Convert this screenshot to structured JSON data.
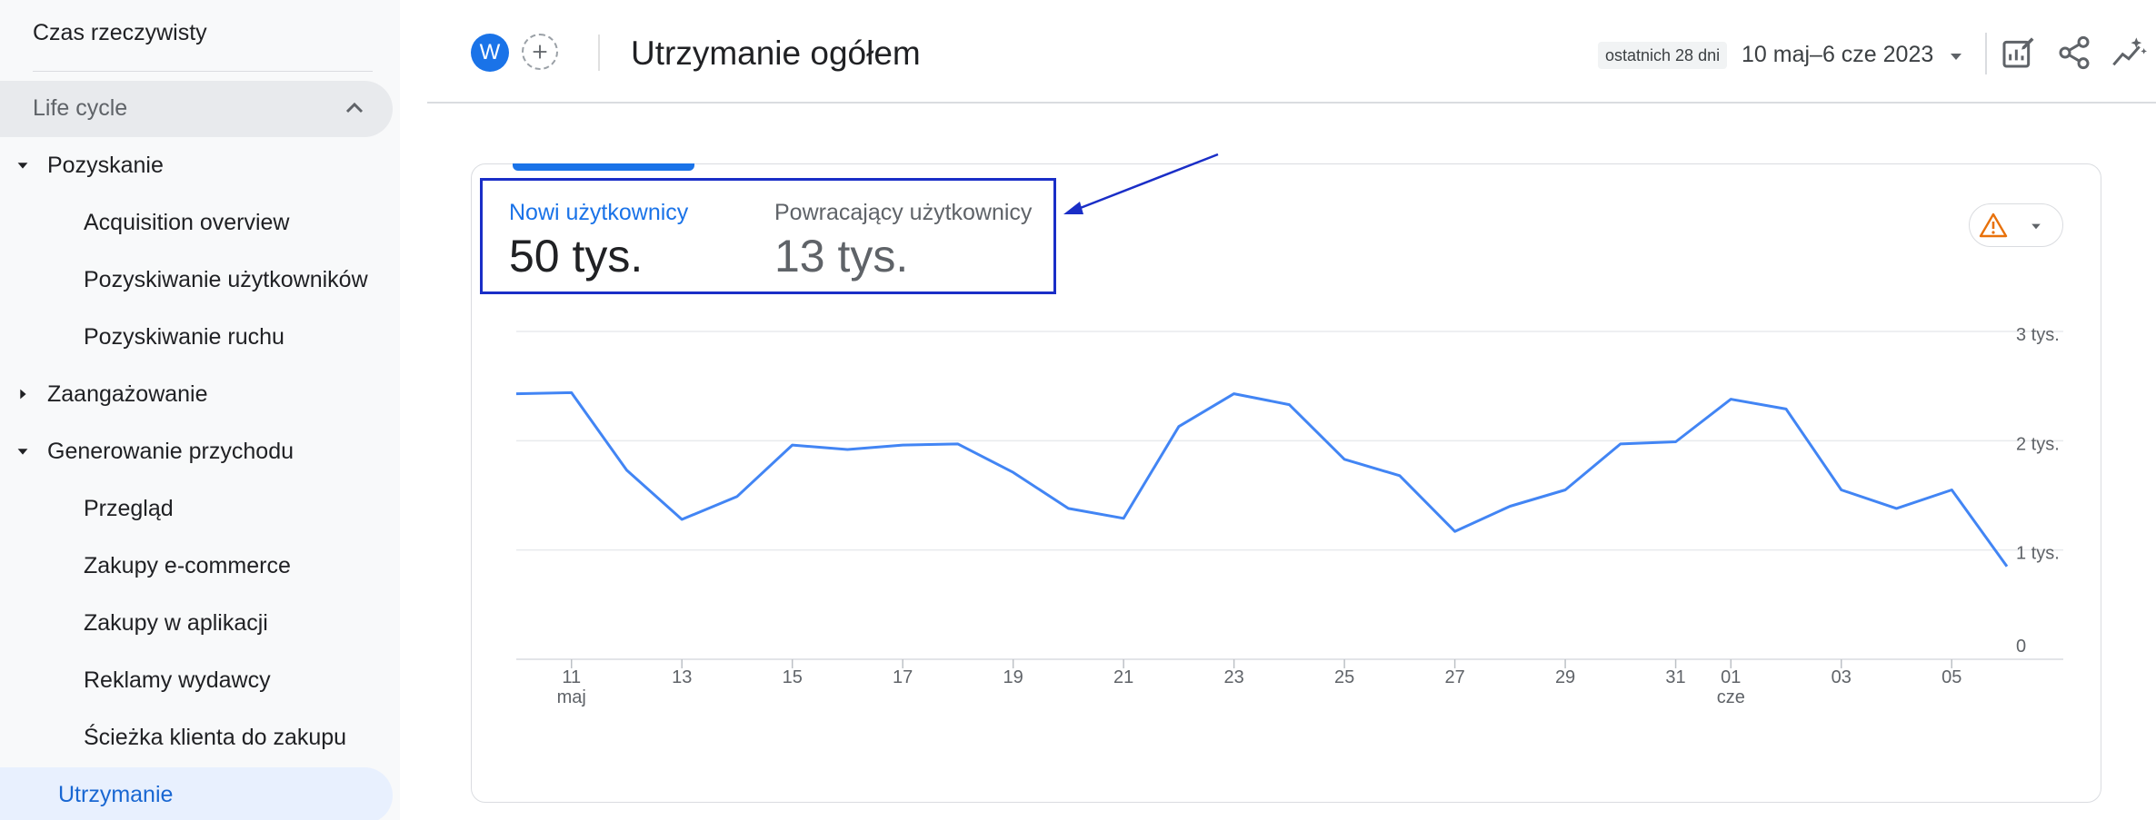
{
  "sidebar": {
    "realtime": "Czas rzeczywisty",
    "section": "Life cycle",
    "items": [
      {
        "label": "Pozyskanie",
        "level": 1,
        "expanded": true
      },
      {
        "label": "Acquisition overview",
        "level": 2
      },
      {
        "label": "Pozyskiwanie użytkowników",
        "level": 2
      },
      {
        "label": "Pozyskiwanie ruchu",
        "level": 2
      },
      {
        "label": "Zaangażowanie",
        "level": 1,
        "expanded": false
      },
      {
        "label": "Generowanie przychodu",
        "level": 1,
        "expanded": true
      },
      {
        "label": "Przegląd",
        "level": 2
      },
      {
        "label": "Zakupy e-commerce",
        "level": 2
      },
      {
        "label": "Zakupy w aplikacji",
        "level": 2
      },
      {
        "label": "Reklamy wydawcy",
        "level": 2
      },
      {
        "label": "Ścieżka klienta do zakupu",
        "level": 2
      }
    ],
    "active": "Utrzymanie"
  },
  "header": {
    "avatar": "W",
    "title": "Utrzymanie ogółem",
    "date_chip": "ostatnich 28 dni",
    "date_range": "10 maj–6 cze 2023",
    "icons": [
      "edit-report-icon",
      "share-icon",
      "insights-icon"
    ]
  },
  "metrics": [
    {
      "label": "Nowi użytkownicy",
      "value": "50 tys.",
      "selected": true
    },
    {
      "label": "Powracający użytkownicy",
      "value": "13 tys.",
      "selected": false
    }
  ],
  "colors": {
    "accent": "#1a73e8",
    "line": "#4285f4",
    "annotation": "#1a2ec7",
    "warning": "#e8710a"
  },
  "chart_data": {
    "type": "line",
    "ylim": [
      0,
      3000
    ],
    "yticks": [
      {
        "value": 0,
        "label": "0"
      },
      {
        "value": 1000,
        "label": "1 tys."
      },
      {
        "value": 2000,
        "label": "2 tys."
      },
      {
        "value": 3000,
        "label": "3 tys."
      }
    ],
    "xticks": [
      {
        "date": "2023-05-11",
        "label": "11",
        "sub": "maj"
      },
      {
        "date": "2023-05-13",
        "label": "13"
      },
      {
        "date": "2023-05-15",
        "label": "15"
      },
      {
        "date": "2023-05-17",
        "label": "17"
      },
      {
        "date": "2023-05-19",
        "label": "19"
      },
      {
        "date": "2023-05-21",
        "label": "21"
      },
      {
        "date": "2023-05-23",
        "label": "23"
      },
      {
        "date": "2023-05-25",
        "label": "25"
      },
      {
        "date": "2023-05-27",
        "label": "27"
      },
      {
        "date": "2023-05-29",
        "label": "29"
      },
      {
        "date": "2023-05-31",
        "label": "31"
      },
      {
        "date": "2023-06-01",
        "label": "01",
        "sub": "cze"
      },
      {
        "date": "2023-06-03",
        "label": "03"
      },
      {
        "date": "2023-06-05",
        "label": "05"
      }
    ],
    "x": [
      "2023-05-10",
      "2023-05-11",
      "2023-05-12",
      "2023-05-13",
      "2023-05-14",
      "2023-05-15",
      "2023-05-16",
      "2023-05-17",
      "2023-05-18",
      "2023-05-19",
      "2023-05-20",
      "2023-05-21",
      "2023-05-22",
      "2023-05-23",
      "2023-05-24",
      "2023-05-25",
      "2023-05-26",
      "2023-05-27",
      "2023-05-28",
      "2023-05-29",
      "2023-05-30",
      "2023-05-31",
      "2023-06-01",
      "2023-06-02",
      "2023-06-03",
      "2023-06-04",
      "2023-06-05",
      "2023-06-06"
    ],
    "values": [
      2430,
      2440,
      1730,
      1280,
      1490,
      1960,
      1920,
      1960,
      1970,
      1710,
      1380,
      1290,
      2130,
      2430,
      2330,
      1830,
      1680,
      1170,
      1400,
      1550,
      1970,
      1990,
      2380,
      2290,
      1550,
      1380,
      1550,
      850
    ],
    "grid": true
  }
}
